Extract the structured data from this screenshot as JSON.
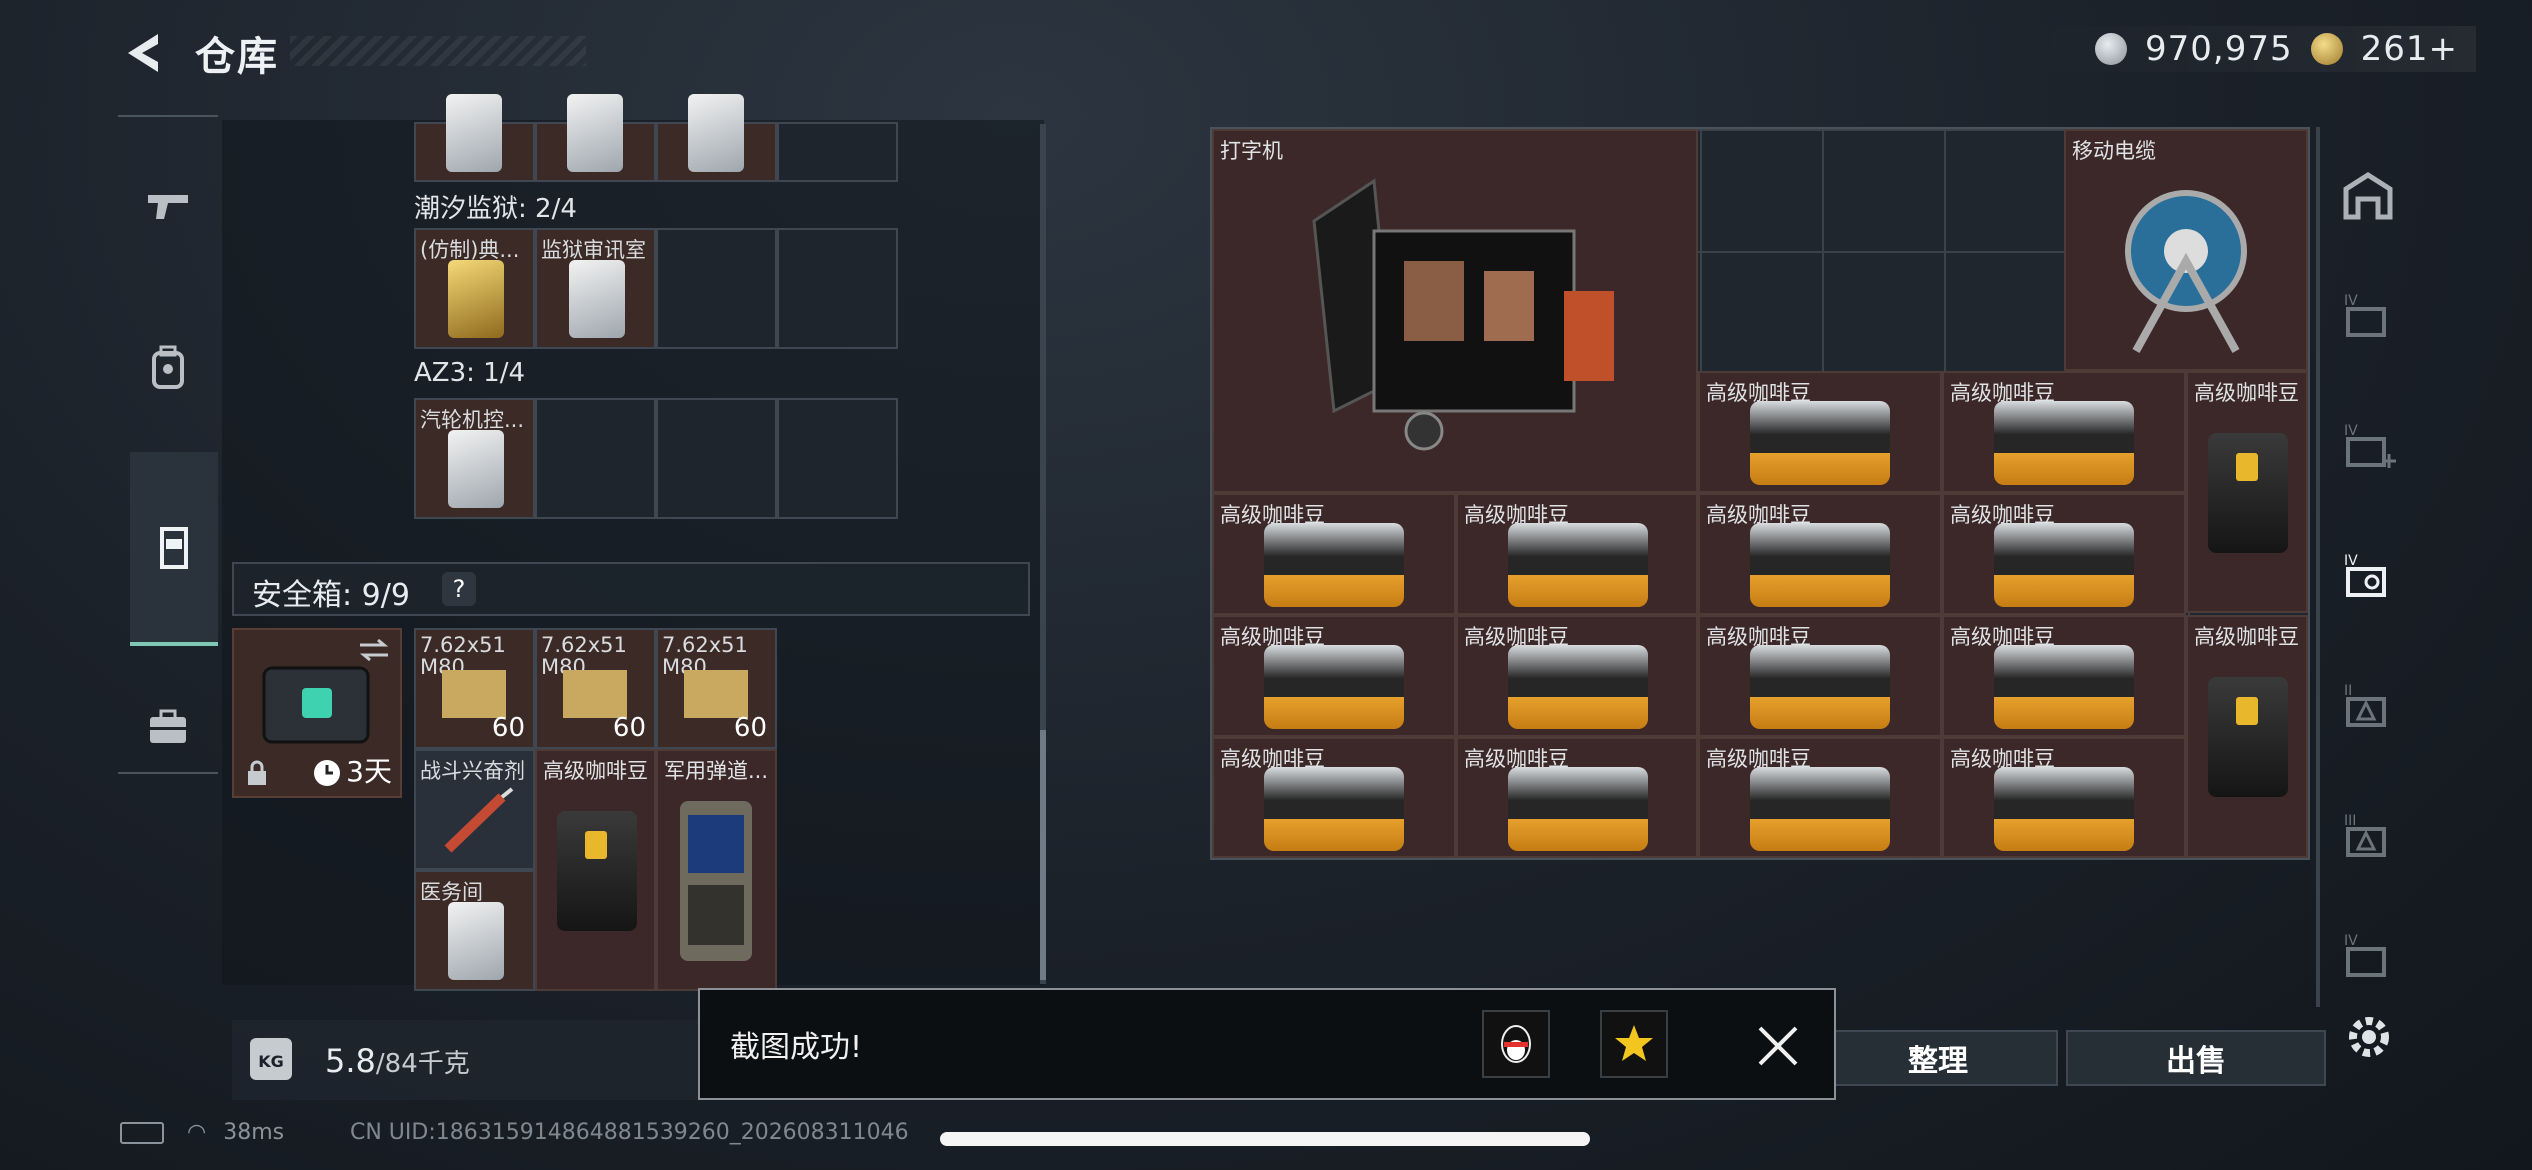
{
  "header": {
    "title": "仓库",
    "currency": [
      {
        "icon": "silver-coin-icon",
        "value": "970,975"
      },
      {
        "icon": "gold-coin-icon",
        "value": "261+"
      }
    ]
  },
  "left_nav": [
    "gun-icon",
    "backpack-icon",
    "vest-icon",
    "briefcase-icon"
  ],
  "left_panel": {
    "top_row_icons": [
      "card-item",
      "card-item",
      "card-item"
    ],
    "sections": [
      {
        "title": "潮汐监狱: 2/4",
        "items": [
          {
            "label": "(仿制)典..."
          },
          {
            "label": "监狱审讯室"
          }
        ]
      },
      {
        "title": "AZ3: 1/4",
        "items": [
          {
            "label": "汽轮机控..."
          }
        ]
      }
    ],
    "safebox": {
      "title": "安全箱:",
      "count": "9/9",
      "help": "?",
      "duration": "3天",
      "items": [
        {
          "label": "7.62x51 M80",
          "count": "60"
        },
        {
          "label": "7.62x51 M80",
          "count": "60"
        },
        {
          "label": "7.62x51 M80",
          "count": "60"
        },
        {
          "label": "战斗兴奋剂"
        },
        {
          "label": "高级咖啡豆"
        },
        {
          "label": "军用弹道..."
        },
        {
          "label": "医务间"
        }
      ]
    },
    "weight": {
      "current": "5.8",
      "max": "/84千克"
    }
  },
  "stash": {
    "typewriter": "打字机",
    "cable": "移动电缆",
    "coffee": "高级咖啡豆"
  },
  "buttons": {
    "sort": "整理",
    "sell": "出售"
  },
  "toast": {
    "message": "截图成功!"
  },
  "status": {
    "ping": "38ms",
    "uid": "CN UID:186315914864881539260_202608311046"
  }
}
